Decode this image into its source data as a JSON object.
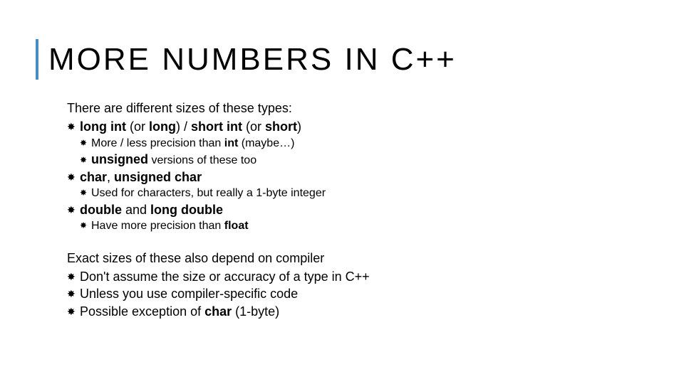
{
  "title": "MORE NUMBERS IN C++",
  "para1": "There are different sizes of these types:",
  "b1": {
    "long": "long int",
    "or_long": " (or ",
    "long2": "long",
    "mid": ") / ",
    "short": "short int",
    "or_short": " (or ",
    "short2": "short",
    "end": ")"
  },
  "b1s1_a": "More / less precision than ",
  "b1s1_int": "int",
  "b1s1_b": " (maybe…)",
  "b1s2_a": "unsigned",
  "b1s2_b": " versions of these too",
  "b2_a": "char",
  "b2_b": ", ",
  "b2_c": "unsigned char",
  "b2s1": "Used for characters, but really a 1-byte integer",
  "b3_a": "double",
  "b3_b": " and ",
  "b3_c": "long double",
  "b3s1_a": "Have more precision than ",
  "b3s1_b": "float",
  "para2": "Exact sizes of these also depend on compiler",
  "c1": "Don't assume the size or accuracy of a type in C++",
  "c2": "Unless you use compiler-specific code",
  "c3_a": "Possible exception of ",
  "c3_b": "char",
  "c3_c": " (1-byte)"
}
